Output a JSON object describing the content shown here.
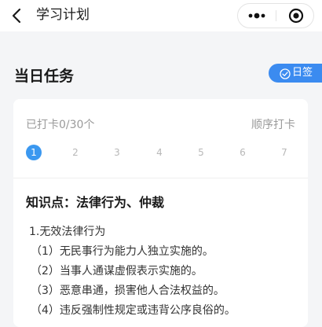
{
  "navbar": {
    "title": "学习计划",
    "back_icon": "chevron-left-icon",
    "more_icon": "more-dots-icon",
    "close_icon": "target-close-icon"
  },
  "section": {
    "title": "当日任务",
    "signin_label": "日签",
    "signin_icon": "check-circle-icon"
  },
  "card": {
    "progress": "已打卡0/30个",
    "mode": "顺序打卡",
    "days": [
      "1",
      "2",
      "3",
      "4",
      "5",
      "6",
      "7"
    ],
    "active_day": "1",
    "knowledge_title": "知识点：法律行为、仲裁",
    "lines": [
      "1.无效法律行为",
      "（1）无民事行为能力人独立实施的。",
      "（2）当事人通谋虚假表示实施的。",
      "（3）恶意串通，损害他人合法权益的。",
      "（4）违反强制性规定或违背公序良俗的。"
    ]
  },
  "colors": {
    "accent": "#3b8bf0",
    "active_day": "#3b98f0",
    "muted_text": "#9a9a9a",
    "background": "#f4f5f7"
  }
}
